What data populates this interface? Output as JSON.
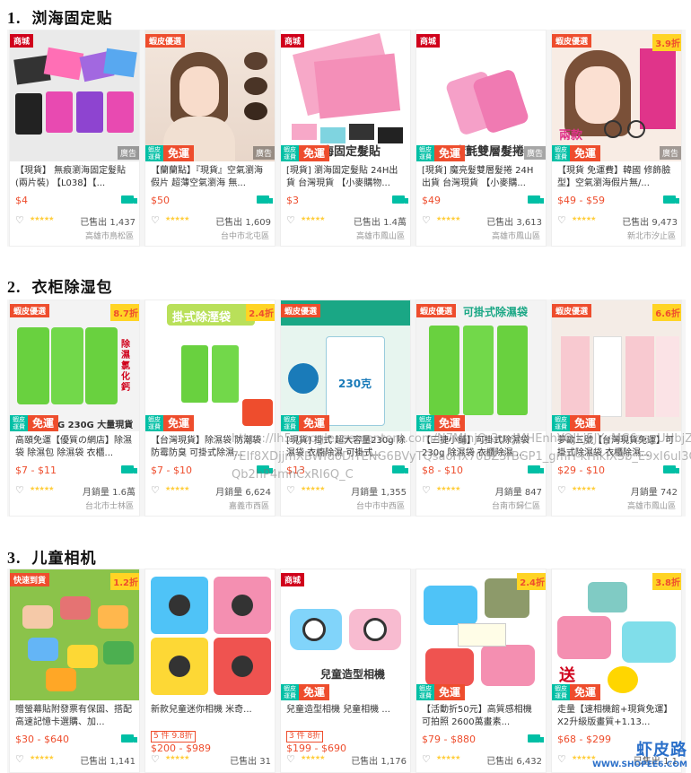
{
  "sections": [
    {
      "number": "1.",
      "title": "浏海固定贴",
      "cards": [
        {
          "badge": "商城",
          "discount": "",
          "ad": "廣告",
          "free_ship": false,
          "title": "【現貨】 無痕瀏海固定髮貼(兩片裝) 【L038】【...",
          "price": "$4",
          "promo": "",
          "sold": "已售出 1,437",
          "location": "高雄市鳥松區",
          "img_text": ""
        },
        {
          "badge": "蝦皮優選",
          "discount": "",
          "ad": "廣告",
          "free_ship": true,
          "title": "【蘭蘭點】『現貨』空氣瀏海假片 超薄空氣瀏海 無...",
          "price": "$50",
          "promo": "",
          "sold": "已售出 1,609",
          "location": "台中市北屯區",
          "img_text": ""
        },
        {
          "badge": "商城",
          "discount": "",
          "ad": "",
          "free_ship": true,
          "title": "[現貨] 瀏海固定髮貼 24H出貨 台灣現貨 【小麥購物...",
          "price": "$3",
          "promo": "",
          "sold": "已售出 1.4萬",
          "location": "高雄市鳳山區",
          "img_text": "海固定髮貼"
        },
        {
          "badge": "商城",
          "discount": "",
          "ad": "廣告",
          "free_ship": true,
          "title": "[現貨] 魔亮髮雙層髮捲 24H出貨 台灣現貨 【小麥購...",
          "price": "$49",
          "promo": "",
          "sold": "已售出 3,613",
          "location": "高雄市鳳山區",
          "img_text": "魔氈雙層髮捲"
        },
        {
          "badge": "蝦皮優選",
          "discount": "3.9折",
          "ad": "廣告",
          "free_ship": true,
          "title": "【現貨 免運費】韓國 修飾臉型】空氣瀏海假片無/...",
          "price": "$49 - $59",
          "promo": "",
          "sold": "已售出 9,473",
          "location": "新北市汐止區",
          "img_text": "兩款"
        }
      ]
    },
    {
      "number": "2.",
      "title": "衣柜除湿包",
      "cards": [
        {
          "badge": "蝦皮優選",
          "discount": "8.7折",
          "ad": "",
          "free_ship": true,
          "title": "高頤免運【優質の網店】除濕袋 除濕包 除濕袋 衣櫃...",
          "price": "$7 - $11",
          "promo": "",
          "sold": "月銷量 1.6萬",
          "location": "台北市士林區",
          "img_text": "0G 230G 大量現貨"
        },
        {
          "badge": "",
          "discount": "2.4折",
          "ad": "",
          "free_ship": true,
          "title": "【台灣現貨】除濕袋 防潮袋 防霉防臭 可掛式除濕...",
          "price": "$7 - $10",
          "promo": "",
          "sold": "月銷量 6,624",
          "location": "嘉義市西區",
          "img_text": "掛式除溼袋"
        },
        {
          "badge": "蝦皮優選",
          "discount": "",
          "ad": "",
          "free_ship": true,
          "title": "[現貨] 掛式 超大容量230g 除濕袋 衣櫥除濕 可掛式...",
          "price": "$13",
          "promo": "",
          "sold": "月銷量 1,355",
          "location": "台中市中西區",
          "img_text": "230克"
        },
        {
          "badge": "蝦皮優選",
          "discount": "",
          "ad": "",
          "free_ship": true,
          "title": "【三捷小舖】可掛式除濕袋 230g 除濕袋 衣櫃除濕 ...",
          "price": "$8 - $10",
          "promo": "",
          "sold": "月銷量 847",
          "location": "台南市歸仁區",
          "img_text": "可掛式除濕袋"
        },
        {
          "badge": "蝦皮優選",
          "discount": "6.6折",
          "ad": "",
          "free_ship": true,
          "title": "夢歐三號【台灣現貨免運】可掛式除濕袋 衣櫃除濕...",
          "price": "$29 - $10",
          "promo": "",
          "sold": "月銷量 742",
          "location": "高雄市鳳山區",
          "img_text": ""
        }
      ]
    },
    {
      "number": "3.",
      "title": "儿童相机",
      "cards": [
        {
          "badge": "快速到貨",
          "discount": "1.2折",
          "ad": "",
          "free_ship": false,
          "title": "贈螢幕貼附發票有保固、搭配高速記憶卡選購、加...",
          "price": "$30 - $640",
          "promo": "",
          "sold": "已售出 1,141",
          "location": "",
          "img_text": ""
        },
        {
          "badge": "",
          "discount": "",
          "ad": "",
          "free_ship": false,
          "title": "新款兒童迷你相機 米奇...",
          "price": "$200 - $989",
          "promo": "5 件 9.8折",
          "sold": "已售出 31",
          "location": "",
          "img_text": ""
        },
        {
          "badge": "商城",
          "discount": "",
          "ad": "",
          "free_ship": true,
          "title": "兒童造型相機 兒童相機 ...",
          "price": "$199 - $690",
          "promo": "3 件 8折",
          "sold": "已售出 1,176",
          "location": "",
          "img_text": "兒童造型相機"
        },
        {
          "badge": "",
          "discount": "2.4折",
          "ad": "",
          "free_ship": true,
          "title": "【活動折50元】高質感相機 可拍照 2600萬畫素...",
          "price": "$79 - $880",
          "promo": "",
          "sold": "已售出 6,432",
          "location": "",
          "img_text": ""
        },
        {
          "badge": "",
          "discount": "3.8折",
          "ad": "",
          "free_ship": true,
          "title": "走量【速相機館+現貨免運】X2升級版畫質+1.13...",
          "price": "$68 - $299",
          "promo": "",
          "sold": "已售出 1,1",
          "location": "",
          "img_text": "送"
        }
      ]
    }
  ],
  "watermark_text": "https://lh5.googleusercontent.com/N7MJnjQ-3uvJMHEnhYOJkj5JYyMC6zayUHbjZ7EIf8XDjjmXBWfdoDiTENG6BVyTQsaoHx70BZ3rBGP1_gmH-kHIkiX3b_E9xI6uI3QQb2hP4mnCxRI6Q_C",
  "logo": {
    "cn": "虾皮路",
    "en": "WWW.SHOPEE6.COM"
  }
}
